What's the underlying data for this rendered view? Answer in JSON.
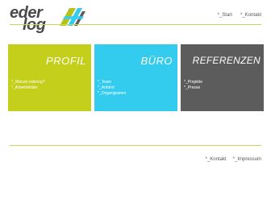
{
  "logo": {
    "word1": "eder",
    "word2": "log",
    "colors": {
      "green": "#b5c21b",
      "blue": "#33ccee",
      "dark": "#5c5c5c"
    }
  },
  "topnav": {
    "start": "*_Start",
    "kontakt": "*_Kontakt"
  },
  "boxes": {
    "profil": {
      "title": "PROFIL",
      "color": "#c3cf1a",
      "links": [
        "*_Warum ederlog?",
        "*_Arbeitsfelder"
      ]
    },
    "buero": {
      "title": "BÜRO",
      "color": "#33ccee",
      "links": [
        "*_Team",
        "*_Anfahrt",
        "*_Organigramm"
      ]
    },
    "referenzen": {
      "title": "REFERENZEN",
      "color": "#5c5c5c",
      "links": [
        "*_Projekte",
        "*_Presse"
      ]
    }
  },
  "bottomnav": {
    "kontakt": "*_Kontakt",
    "impressum": "*_Impressum"
  }
}
